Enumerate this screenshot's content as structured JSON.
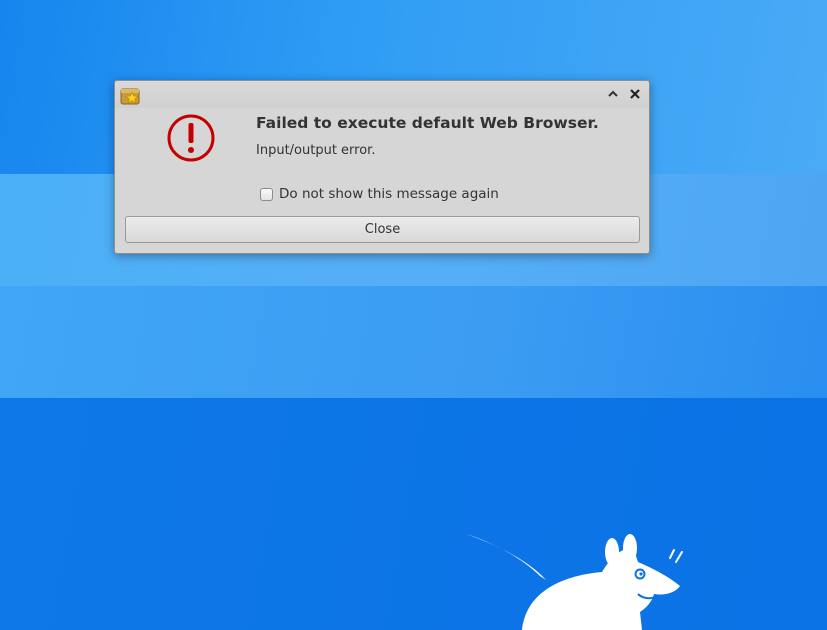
{
  "dialog": {
    "title_text": "Failed to execute default Web Browser.",
    "detail_text": "Input/output error.",
    "checkbox_label": "Do not show this message again",
    "checkbox_checked": false,
    "close_button_label": "Close",
    "titlebar_buttons": {
      "shade_glyph": "⌃",
      "close_glyph": "✕"
    },
    "icons": {
      "app": "app-icon",
      "error": "error-exclamation-icon"
    },
    "colors": {
      "error_icon": "#c40000",
      "dialog_bg": "#d6d6d6"
    }
  },
  "desktop": {
    "wallpaper": "xfce-mouse-logo",
    "colors": {
      "primary_blue": "#0a72e4",
      "light_band": "#4bb0f7"
    }
  }
}
